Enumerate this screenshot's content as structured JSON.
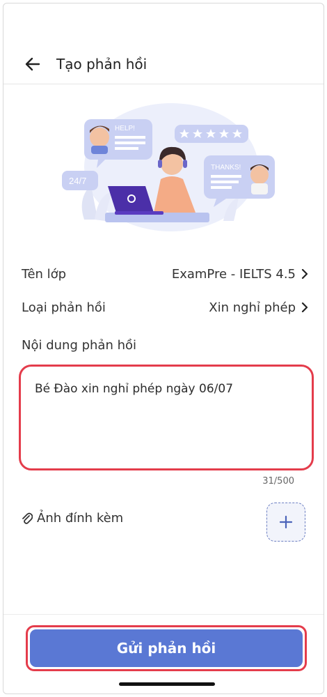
{
  "header": {
    "title": "Tạo phản hồi"
  },
  "illustration": {
    "help_text": "HELP!",
    "thanks_text": "THANKS!",
    "hours_text": "24/7"
  },
  "form": {
    "class_label": "Tên lớp",
    "class_value": "ExamPre - IELTS 4.5",
    "type_label": "Loại phản hồi",
    "type_value": "Xin nghỉ phép",
    "content_label": "Nội dung phản hồi",
    "content_value": "Bé Đào xin nghỉ phép ngày 06/07",
    "counter": "31/500",
    "attachment_label": "Ảnh đính kèm"
  },
  "footer": {
    "submit_label": "Gửi phản hồi"
  },
  "colors": {
    "accent": "#5a78d4",
    "highlight": "#e43c4b",
    "illustration": "#c9d0f3"
  }
}
